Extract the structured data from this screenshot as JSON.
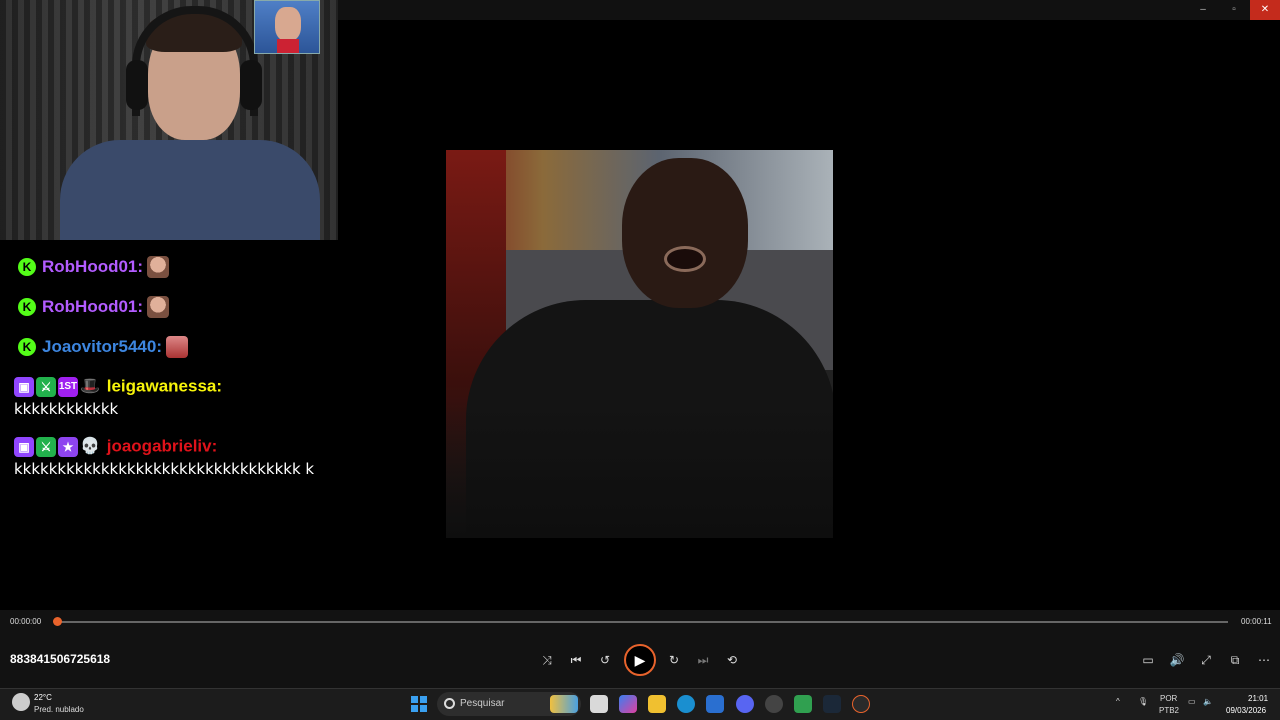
{
  "window": {
    "minimize": "–",
    "maximize": "▫",
    "close": "✕"
  },
  "chat": [
    {
      "user": "RobHood01:",
      "color": "#b35cff",
      "text": ""
    },
    {
      "user": "RobHood01:",
      "color": "#b35cff",
      "text": ""
    },
    {
      "user": "Joaovitor5440:",
      "color": "#3d86e0",
      "text": ""
    },
    {
      "user": "leigawanessa:",
      "color": "#f7f40a",
      "text": "kkkkkkkkkkkk"
    },
    {
      "user": "joaogabrieliv:",
      "color": "#e0121a",
      "text": "kkkkkkkkkkkkkkkkkkkkkkkkkkkkkkkkk k"
    }
  ],
  "badges": {
    "first": "1ST"
  },
  "player": {
    "current_time": "00:00:00",
    "total_time": "00:00:11",
    "progress": 0.0,
    "file_name": "883841506725618",
    "accent": "#e8632c"
  },
  "taskbar": {
    "weather_temp": "22°C",
    "weather_desc": "Pred. nublado",
    "search_placeholder": "Pesquisar",
    "lang_top": "POR",
    "lang_bottom": "PTB2",
    "time": "21:01",
    "date": "09/03/2026"
  }
}
